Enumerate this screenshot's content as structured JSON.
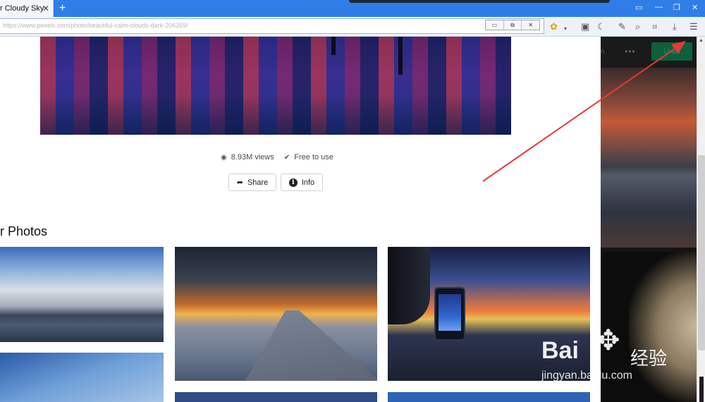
{
  "browser": {
    "tab_title": "r Cloudy Sky",
    "tab_close": "✕",
    "new_tab": "+",
    "address": "https://www.pexels.com/photo/beautiful-calm-clouds-dark-206359/",
    "window_controls": [
      "▭",
      "—",
      "❐",
      "✕"
    ],
    "popup_controls": [
      "▭",
      "⧉",
      "✕"
    ]
  },
  "toolbar_icons": [
    "bee-icon",
    "briefcase-icon",
    "night-mode-icon",
    "puzzle-icon",
    "search-plus-icon",
    "crop-icon",
    "download-icon",
    "menu-icon"
  ],
  "photo": {
    "views": "8.93M views",
    "license": "Free to use",
    "share_label": "Share",
    "info_label": "Info"
  },
  "section": {
    "title": "r Photos"
  },
  "right_panel": {
    "partial_text": "n",
    "more": "•••",
    "button_label": "U  ad"
  },
  "watermark": {
    "brand": "Bai",
    "chinese": "经验",
    "url": "jingyan.baidu.com"
  },
  "colors": {
    "tab_bar": "#2f7ee8",
    "annotation_arrow": "#e53935"
  }
}
